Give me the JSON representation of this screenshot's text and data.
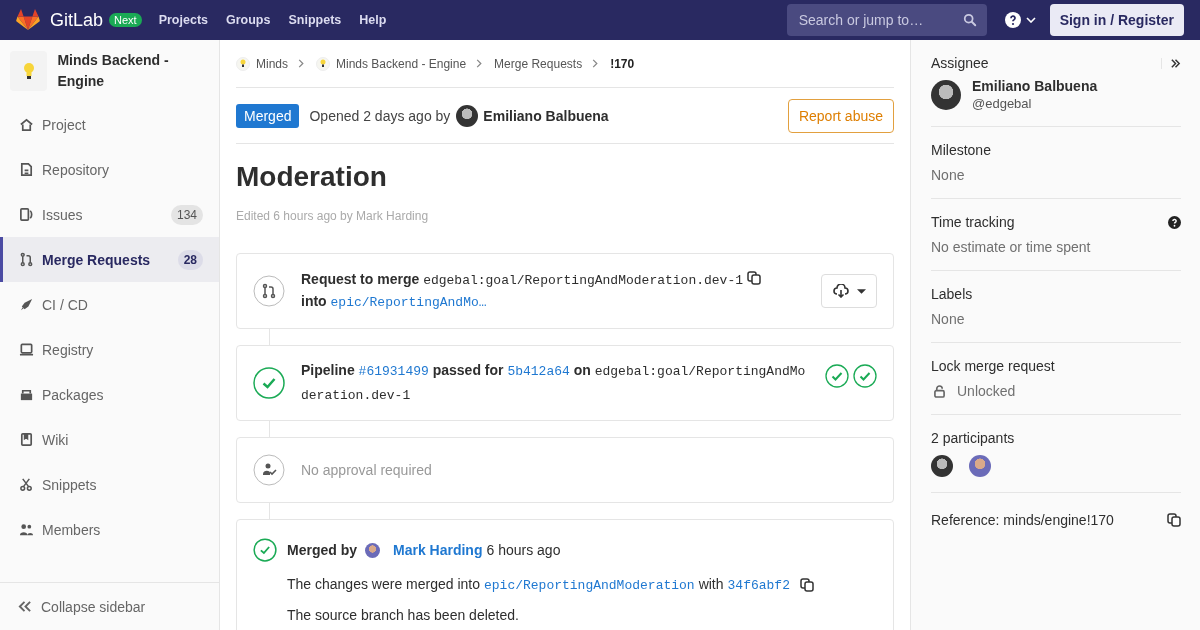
{
  "navbar": {
    "brand": "GitLab",
    "badge": "Next",
    "links": [
      "Projects",
      "Groups",
      "Snippets",
      "Help"
    ],
    "search": {
      "placeholder": "Search or jump to…"
    },
    "sign_in": "Sign in / Register"
  },
  "sidebar": {
    "project": "Minds Backend - Engine",
    "items": [
      {
        "label": "Project",
        "selected": false
      },
      {
        "label": "Repository",
        "selected": false
      },
      {
        "label": "Issues",
        "count": "134",
        "selected": false
      },
      {
        "label": "Merge Requests",
        "count": "28",
        "selected": true
      },
      {
        "label": "CI / CD",
        "selected": false
      },
      {
        "label": "Registry",
        "selected": false
      },
      {
        "label": "Packages",
        "selected": false
      },
      {
        "label": "Wiki",
        "selected": false
      },
      {
        "label": "Snippets",
        "selected": false
      },
      {
        "label": "Members",
        "selected": false
      }
    ],
    "collapse": "Collapse sidebar"
  },
  "breadcrumbs": [
    {
      "label": "Minds",
      "avatar": true
    },
    {
      "label": "Minds Backend - Engine",
      "avatar": true
    },
    {
      "label": "Merge Requests",
      "avatar": false
    },
    {
      "label": "!170",
      "avatar": false
    }
  ],
  "header": {
    "status": "Merged",
    "opened": "Opened 2 days ago by",
    "author": "Emiliano Balbuena",
    "report": "Report abuse"
  },
  "title": "Moderation",
  "edited": "Edited 6 hours ago by Mark Harding",
  "widgets": [
    {
      "kind": "request",
      "label": "Request to merge",
      "source": "edgebal:goal/ReportingAndModeration.dev-1",
      "into": "into",
      "target": "epic/ReportingAndMo…"
    },
    {
      "kind": "pipeline",
      "label": "Pipeline",
      "pipeline": "#61931499",
      "passed": "passed for",
      "commit": "5b412a64",
      "on": "on",
      "branch": "edgebal:goal/ReportingAndModeration.dev-1"
    },
    {
      "kind": "approval",
      "text": "No approval required"
    },
    {
      "kind": "merged",
      "label": "Merged by",
      "user": "Mark Harding",
      "time": "6 hours ago",
      "lines": [
        {
          "pre": "The changes were merged into",
          "branch": "epic/ReportingAndModeration",
          "mid": "with",
          "commit": "34f6abf2"
        },
        {
          "pre": "The source branch has been deleted."
        }
      ]
    }
  ],
  "right_sidebar": {
    "assignee": {
      "label": "Assignee",
      "name": "Emiliano Balbuena",
      "username": "@edgebal"
    },
    "sections": [
      {
        "kind": "text",
        "label": "Milestone",
        "value": "None"
      },
      {
        "kind": "help",
        "label": "Time tracking",
        "value": "No estimate or time spent"
      },
      {
        "kind": "text",
        "label": "Labels",
        "value": "None"
      },
      {
        "kind": "lock",
        "label": "Lock merge request",
        "value": "Unlocked"
      },
      {
        "kind": "participants",
        "label": "2 participants",
        "people": [
          {
            "kind": "dark"
          },
          {
            "kind": "purple"
          }
        ]
      },
      {
        "kind": "reference",
        "label": "Reference: minds/engine!170"
      }
    ]
  }
}
